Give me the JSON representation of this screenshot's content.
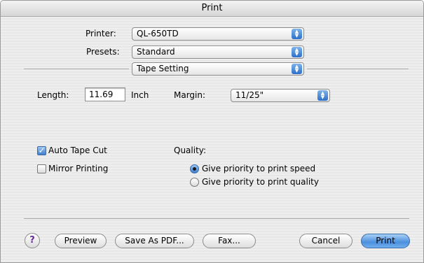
{
  "window": {
    "title": "Print"
  },
  "printer": {
    "label": "Printer:",
    "value": "QL-650TD"
  },
  "presets": {
    "label": "Presets:",
    "value": "Standard"
  },
  "panel": {
    "value": "Tape Setting"
  },
  "length": {
    "label": "Length:",
    "value": "11.69",
    "unit": "Inch"
  },
  "margin": {
    "label": "Margin:",
    "value": "11/25\""
  },
  "options": {
    "auto_tape_cut": {
      "label": "Auto Tape Cut",
      "checked": true
    },
    "mirror_printing": {
      "label": "Mirror Printing",
      "checked": false
    }
  },
  "quality": {
    "label": "Quality:",
    "speed": {
      "label": "Give priority to print speed",
      "selected": true
    },
    "quality": {
      "label": "Give priority to print quality",
      "selected": false
    }
  },
  "buttons": {
    "help": "?",
    "preview": "Preview",
    "save_pdf": "Save As PDF...",
    "fax": "Fax...",
    "cancel": "Cancel",
    "print": "Print"
  },
  "colors": {
    "accent": "#3f7fd0",
    "default_button": "#4b8fdc"
  },
  "icons": {
    "popup_arrows": "up-down-arrows-icon",
    "check": "checkmark-icon",
    "help": "help-icon"
  }
}
